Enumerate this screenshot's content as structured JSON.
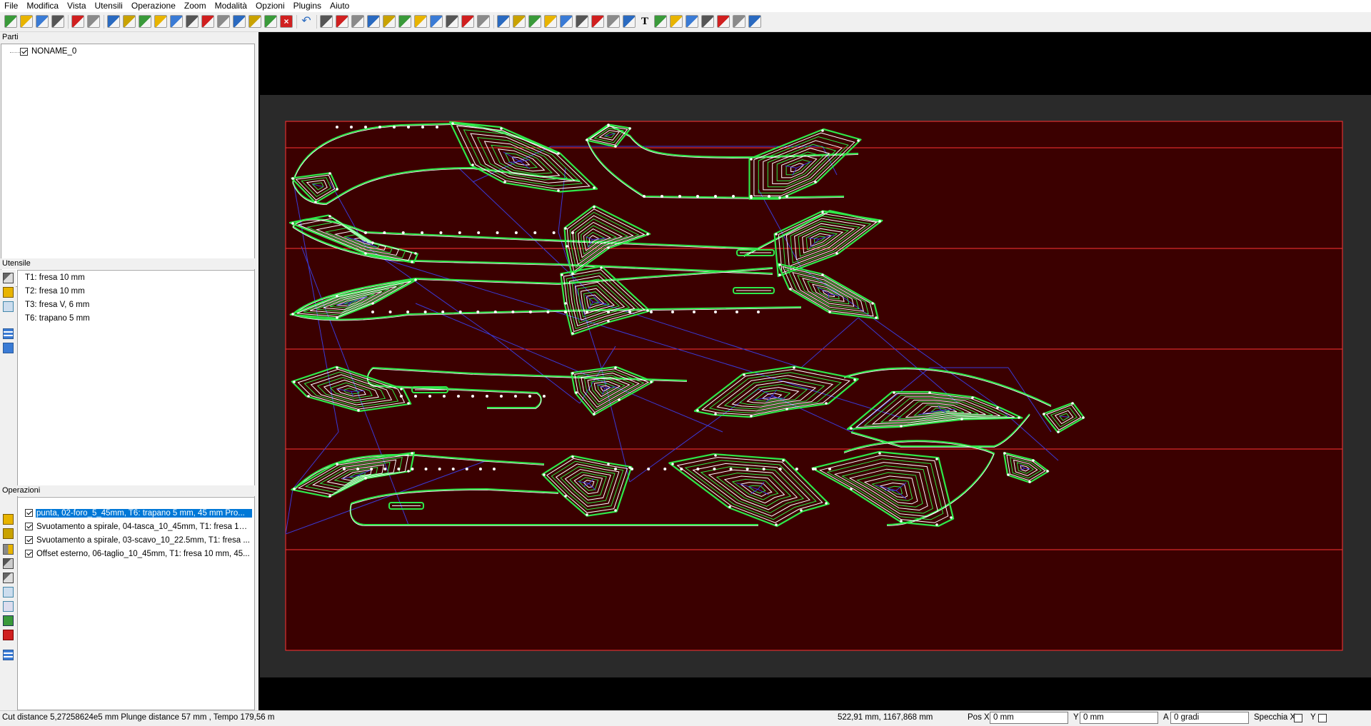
{
  "menu": [
    "File",
    "Modifica",
    "Vista",
    "Utensili",
    "Operazione",
    "Zoom",
    "Modalità",
    "Opzioni",
    "Plugins",
    "Aiuto"
  ],
  "panels": {
    "parti": {
      "title": "Parti",
      "items": [
        {
          "label": "NONAME_0",
          "checked": true
        }
      ]
    },
    "utensile": {
      "title": "Utensile",
      "items": [
        "T1: fresa 10 mm",
        "T2: fresa 10 mm",
        "T3: fresa V, 6 mm",
        "T6: trapano 5 mm"
      ]
    },
    "operazioni": {
      "title": "Operazioni",
      "items": [
        {
          "label": "punta, 02-foro_5_45mm, T6: trapano 5 mm, 45 mm Pro...",
          "checked": true,
          "selected": true
        },
        {
          "label": "Svuotamento a spirale, 04-tasca_10_45mm, T1: fresa 10 ...",
          "checked": true,
          "selected": false
        },
        {
          "label": "Svuotamento a spirale, 03-scavo_10_22.5mm, T1: fresa ...",
          "checked": true,
          "selected": false
        },
        {
          "label": "Offset esterno, 06-taglio_10_45mm, T1: fresa 10 mm, 45...",
          "checked": true,
          "selected": false
        }
      ]
    }
  },
  "status": {
    "left": "Cut distance 5,27258624e5 mm Plunge distance 57 mm , Tempo 179,56 m",
    "coords": "522,91 mm, 1167,868 mm",
    "posx_label": "Pos X",
    "posx_value": "0 mm",
    "y_label": "Y",
    "y_value": "0 mm",
    "a_label": "A",
    "a_value": "0 gradi",
    "mirror_x_label": "Specchia X",
    "mirror_y_label": "Y"
  },
  "colors": {
    "sheet_fill": "#3b0000",
    "sheet_border": "#ff3333",
    "toolpath_outer": "#2eea4a",
    "toolpath_inner": "#ffffff",
    "rapid_moves": "#3a3ad8",
    "selection": "#0078d7"
  },
  "icons": {
    "toolbar": [
      "new-file-icon",
      "edit-file-icon",
      "print-preview-icon",
      "print-icon",
      "calculator-icon",
      "tool-user-icon",
      "add-group-icon",
      "nest-icon",
      "array-icon",
      "stack-icon",
      "align-icon",
      "copy-part-icon",
      "merge-icon",
      "snap-icon",
      "drill-group-icon",
      "path-group-icon",
      "simulate-icon",
      "delete-icon",
      "undo-icon",
      "view-3d-icon",
      "layers-icon",
      "sheet-icon",
      "select-toolpath-icon",
      "node-edit-icon",
      "curve-icon",
      "offset-icon",
      "lead-in-icon",
      "tab-icon",
      "start-point-icon",
      "bridge-icon",
      "select-arrow-icon",
      "move-icon",
      "rotate-icon",
      "scale-icon",
      "mirror-icon",
      "pan-icon",
      "crop-icon",
      "frame-icon",
      "measure-icon",
      "text-icon",
      "zoom-in-icon",
      "zoom-out-icon",
      "zoom-window-icon",
      "zoom-all-icon",
      "zoom-fit-icon",
      "zoom-part-icon",
      "zoom-prev-icon"
    ]
  }
}
